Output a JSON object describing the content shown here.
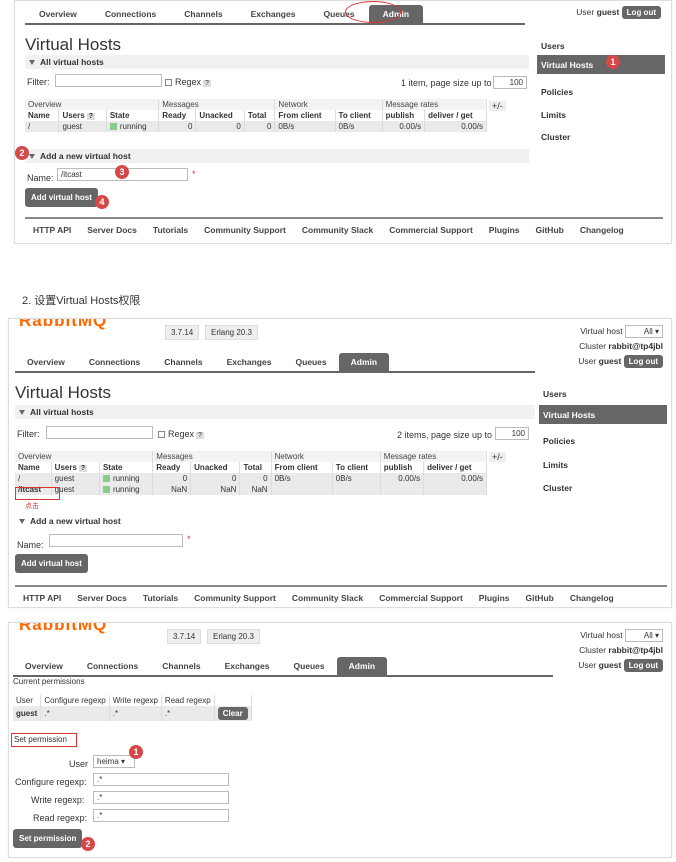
{
  "nav": {
    "tabs": [
      "Overview",
      "Connections",
      "Channels",
      "Exchanges",
      "Queues",
      "Admin"
    ]
  },
  "header": {
    "user_label": "User",
    "user_name": "guest",
    "logout": "Log out",
    "vhost_label": "Virtual host",
    "vhost_value": "All",
    "cluster_label": "Cluster",
    "cluster_value": "rabbit@tp4jbl",
    "version": "3.7.14",
    "erlang": "Erlang 20.3",
    "logo": "RabbitMQ"
  },
  "sidebar": {
    "items": [
      "Users",
      "Virtual Hosts",
      "Policies",
      "Limits",
      "Cluster"
    ]
  },
  "page": {
    "title": "Virtual Hosts",
    "all_section": "All virtual hosts",
    "filter_label": "Filter:",
    "regex_label": "Regex",
    "help_q": "?",
    "paging1": "1 item, page size up to",
    "paging2": "2 items, page size up to",
    "page_size": "100",
    "plusminus": "+/-"
  },
  "table": {
    "groups": [
      "Overview",
      "Messages",
      "Network",
      "Message rates"
    ],
    "headers": [
      "Name",
      "Users",
      "State",
      "Ready",
      "Unacked",
      "Total",
      "From client",
      "To client",
      "publish",
      "deliver / get"
    ],
    "rows1": [
      [
        "/",
        "guest",
        "running",
        "0",
        "0",
        "0",
        "0B/s",
        "0B/s",
        "0.00/s",
        "0.00/s"
      ]
    ],
    "rows2": [
      [
        "/",
        "guest",
        "running",
        "0",
        "0",
        "0",
        "0B/s",
        "0B/s",
        "0.00/s",
        "0.00/s"
      ],
      [
        "/itcast",
        "guest",
        "running",
        "NaN",
        "NaN",
        "NaN",
        "",
        "",
        "",
        ""
      ]
    ]
  },
  "add": {
    "section": "Add a new virtual host",
    "name_label": "Name:",
    "name_value": "/itcast",
    "required": "*",
    "button": "Add virtual host"
  },
  "footer": {
    "links": [
      "HTTP API",
      "Server Docs",
      "Tutorials",
      "Community Support",
      "Community Slack",
      "Commercial Support",
      "Plugins",
      "GitHub",
      "Changelog"
    ]
  },
  "heading2": "2. 设置Virtual Hosts权限",
  "click_note": "点击",
  "perm": {
    "current": "Current permissions",
    "headers": [
      "User",
      "Configure regexp",
      "Write regexp",
      "Read regexp"
    ],
    "row": [
      "guest",
      ".*",
      ".*",
      ".*"
    ],
    "clear": "Clear",
    "set_section": "Set permission",
    "user_label": "User",
    "user_value": "heima",
    "configure_label": "Configure regexp:",
    "write_label": "Write regexp:",
    "read_label": "Read regexp:",
    "regex_value": ".*",
    "button": "Set permission"
  },
  "markers": [
    "1",
    "2",
    "3",
    "4"
  ]
}
